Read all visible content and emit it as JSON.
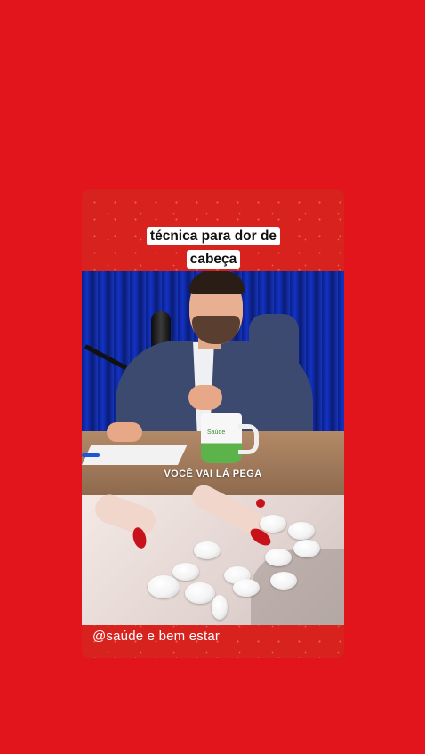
{
  "post": {
    "caption": "técnica para dor de cabeça",
    "subtitle": "VOCÊ VAI LÁ PEGA",
    "handle": "@saúde e bem estar",
    "mug_logo": "Saúde"
  },
  "colors": {
    "background": "#e3151c",
    "card": "#d8221e",
    "caption_bg": "#ffffff",
    "nail_polish": "#c8121b",
    "mug_green": "#5cb34a"
  }
}
